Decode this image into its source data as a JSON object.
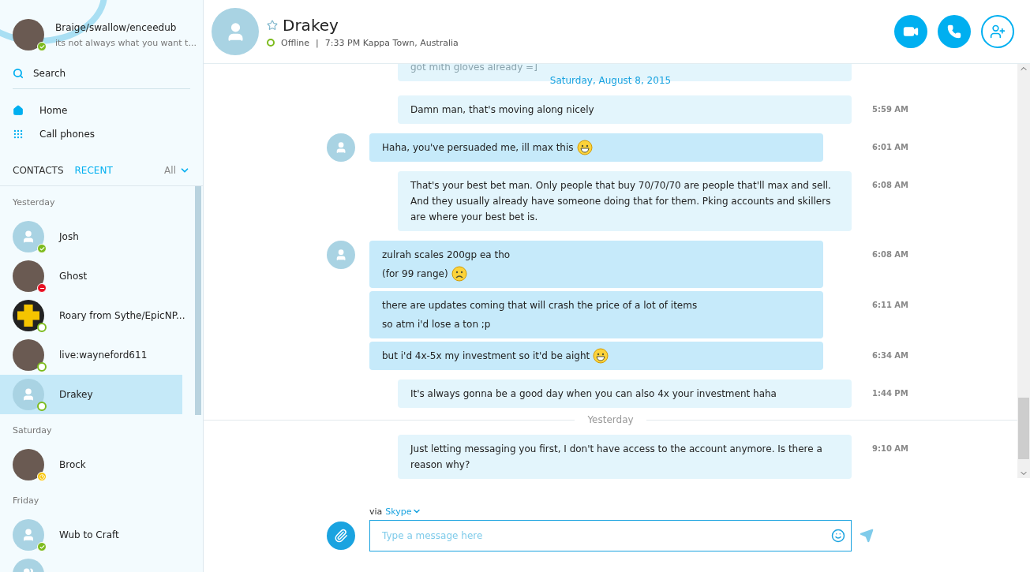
{
  "profile": {
    "name": "Braige/swallow/enceedub",
    "mood": "its not always what you want t...",
    "presence": {
      "kind": "online"
    }
  },
  "search": {
    "label": "Search"
  },
  "nav": [
    {
      "kind": "home",
      "label": "Home"
    },
    {
      "kind": "dialpad",
      "label": "Call phones"
    }
  ],
  "tabs": [
    {
      "label": "CONTACTS",
      "selected": false
    },
    {
      "label": "RECENT",
      "selected": true
    }
  ],
  "filter": {
    "label": "All"
  },
  "recent_groups": [
    {
      "label": "Yesterday",
      "contacts": [
        {
          "name": "Josh",
          "presence": {
            "kind": "online"
          },
          "avatar": {
            "kind": "default"
          },
          "selected": false
        },
        {
          "name": "Ghost",
          "presence": {
            "kind": "busy"
          },
          "avatar": {
            "kind": "photo"
          },
          "selected": false
        },
        {
          "name": "Roary from Sythe/EpicNP...",
          "presence": {
            "kind": "offline"
          },
          "avatar": {
            "kind": "logo"
          },
          "selected": false
        },
        {
          "name": "live:wayneford611",
          "presence": {
            "kind": "offline"
          },
          "avatar": {
            "kind": "photo"
          },
          "selected": false
        },
        {
          "name": "Drakey",
          "presence": {
            "kind": "offline"
          },
          "avatar": {
            "kind": "default"
          },
          "selected": true
        }
      ]
    },
    {
      "label": "Saturday",
      "contacts": [
        {
          "name": "Brock",
          "presence": {
            "kind": "away"
          },
          "avatar": {
            "kind": "photo"
          },
          "selected": false
        }
      ]
    },
    {
      "label": "Friday",
      "contacts": [
        {
          "name": "Wub to Craft",
          "presence": {
            "kind": "online"
          },
          "avatar": {
            "kind": "default"
          },
          "selected": false
        },
        {
          "avatar": {
            "kind": "group"
          },
          "selected": false
        }
      ]
    }
  ],
  "chat_header": {
    "name": "Drakey",
    "favorite": false,
    "presence": {
      "kind": "offline"
    },
    "status_text": "Offline",
    "separator": "|",
    "details": "7:33 PM Kappa Town, Australia"
  },
  "messages": [
    {
      "kind": "faded",
      "lines": [
        "got mith gloves already =]"
      ]
    },
    {
      "kind": "date",
      "label": "Saturday, August 8, 2015"
    },
    {
      "kind": "sent",
      "lines": [
        "Damn man, that's moving along nicely"
      ],
      "time": "5:59 AM"
    },
    {
      "kind": "received",
      "avatar": true,
      "lines": [
        "Haha, you've persuaded me, ill max this"
      ],
      "emoticon": {
        "kind": "grin"
      },
      "time": "6:01 AM"
    },
    {
      "kind": "sent",
      "lines": [
        "That's your best bet man. Only people that buy 70/70/70 are people that'll max and sell. And they usually already have someone doing that for them. Pking accounts and skillers are where your best bet is."
      ],
      "time": "6:08 AM"
    },
    {
      "kind": "received",
      "avatar": true,
      "lines": [
        "zulrah scales 200gp ea tho",
        "(for 99 range)"
      ],
      "emoticon": {
        "kind": "worried"
      },
      "time": "6:08 AM"
    },
    {
      "kind": "received",
      "avatar": false,
      "lines": [
        "there are updates coming that will crash the price of a lot of items",
        "so atm i'd lose a ton ;p"
      ],
      "time": "6:11 AM"
    },
    {
      "kind": "received",
      "avatar": false,
      "lines": [
        "but i'd 4x-5x my investment so it'd be aight"
      ],
      "emoticon": {
        "kind": "grin"
      },
      "time": "6:34 AM"
    },
    {
      "kind": "sent",
      "lines": [
        "It's always gonna be a good day when you can also 4x your investment haha"
      ],
      "time": "1:44 PM"
    },
    {
      "kind": "divider",
      "label": "Yesterday"
    },
    {
      "kind": "sent",
      "lines": [
        "Just letting messaging you first, I don't have access to the account anymore. Is there a reason why?"
      ],
      "time": "9:10 AM"
    }
  ],
  "composer": {
    "via": "via",
    "service": "Skype",
    "placeholder": "Type a message here"
  }
}
